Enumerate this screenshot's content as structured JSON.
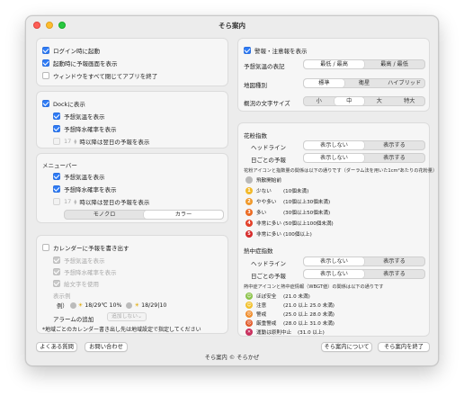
{
  "window": {
    "title": "そら案内"
  },
  "startup": {
    "items": [
      {
        "label": "ログイン時に起動",
        "checked": true
      },
      {
        "label": "起動時に予報画面を表示",
        "checked": true
      },
      {
        "label": "ウィンドウをすべて閉じてアプリを終了",
        "checked": false
      }
    ]
  },
  "dock": {
    "show_label": "Dockに表示",
    "temp_label": "予想気温を表示",
    "rain_label": "予想降水確率を表示",
    "hour_value": "17",
    "hour_suffix": "時以降は翌日の予報を表示"
  },
  "menubar": {
    "heading": "メニューバー",
    "temp_label": "予想気温を表示",
    "rain_label": "予想降水確率を表示",
    "hour_value": "17",
    "hour_suffix": "時以降は翌日の予報を表示",
    "style_options": [
      "モノクロ",
      "カラー"
    ],
    "style_selected": "カラー"
  },
  "calendar": {
    "write_label": "カレンダーに予報を書き出す",
    "temp_label": "予想気温を表示",
    "rain_label": "予想降水確率を表示",
    "emoji_label": "絵文字を使用",
    "preview_label": "表示例",
    "example_label": "例）",
    "example_text1": "18/29℃ 10%",
    "example_text2": "18/29|10",
    "alarm_label": "アラームの追加",
    "alarm_value": "追加しない",
    "note": "*地域ごとのカレンダー書き出し先は地域設定で指定してください"
  },
  "alerts": {
    "show_label": "警報・注意報を表示",
    "temp_format_label": "予想気温の表記",
    "temp_format_options": [
      "最低 / 最高",
      "最高 / 最低"
    ],
    "temp_format_selected": "最低 / 最高",
    "map_type_label": "地図種別",
    "map_type_options": [
      "標準",
      "衛星",
      "ハイブリッド"
    ],
    "map_type_selected": "標準",
    "font_size_label": "概況の文字サイズ",
    "font_size_options": [
      "小",
      "中",
      "大",
      "特大"
    ],
    "font_size_selected": "中"
  },
  "pollen": {
    "heading": "花粉指数",
    "headline_label": "ヘッドライン",
    "daily_label": "日ごとの予報",
    "options": [
      "表示しない",
      "表示する"
    ],
    "headline_selected": "表示しない",
    "daily_selected": "表示しない",
    "description": "花粉アイコンと指数量の関係は以下の通りです（ダーラム法を用いた1cm²あたりの花粉量）",
    "levels": [
      {
        "icon": "",
        "name": "飛散開始前",
        "range": "",
        "color": "#b9b9b9"
      },
      {
        "icon": "1",
        "name": "少ない",
        "range": "(10個未満)",
        "color": "#f2b92b"
      },
      {
        "icon": "2",
        "name": "やや多い",
        "range": "(10個以上30個未満)",
        "color": "#f0992b"
      },
      {
        "icon": "3",
        "name": "多い",
        "range": "(30個以上50個未満)",
        "color": "#ec6b23"
      },
      {
        "icon": "4",
        "name": "非常に多い",
        "range": "(50個以上100個未満)",
        "color": "#e3402a"
      },
      {
        "icon": "5",
        "name": "非常に多い",
        "range": "(100個以上)",
        "color": "#d62b2b"
      }
    ]
  },
  "heatstroke": {
    "heading": "熱中症指数",
    "headline_label": "ヘッドライン",
    "daily_label": "日ごとの予報",
    "options": [
      "表示しない",
      "表示する"
    ],
    "headline_selected": "表示しない",
    "daily_selected": "表示しない",
    "description": "熱中症アイコンと熱中症情報（WBGT値）の関係は以下の通りです",
    "levels": [
      {
        "name": "ほぼ安全",
        "range": "(21.0 未満)",
        "color": "#8bc34a"
      },
      {
        "name": "注意",
        "range": "(21.0 以上 25.0 未満)",
        "color": "#f2c12b"
      },
      {
        "name": "警戒",
        "range": "(25.0 以上 28.0 未満)",
        "color": "#f08c2b"
      },
      {
        "name": "厳重警戒",
        "range": "(28.0 以上 31.0 未満)",
        "color": "#e25b2a"
      },
      {
        "name": "運動は原則中止",
        "range": "(31.0 以上)",
        "color": "#c9305e"
      }
    ]
  },
  "footer": {
    "faq_label": "よくある質問",
    "contact_label": "お問い合わせ",
    "credit": "そら案内 © そらかぜ",
    "about_label": "そら案内について",
    "quit_label": "そら案内を終了"
  }
}
